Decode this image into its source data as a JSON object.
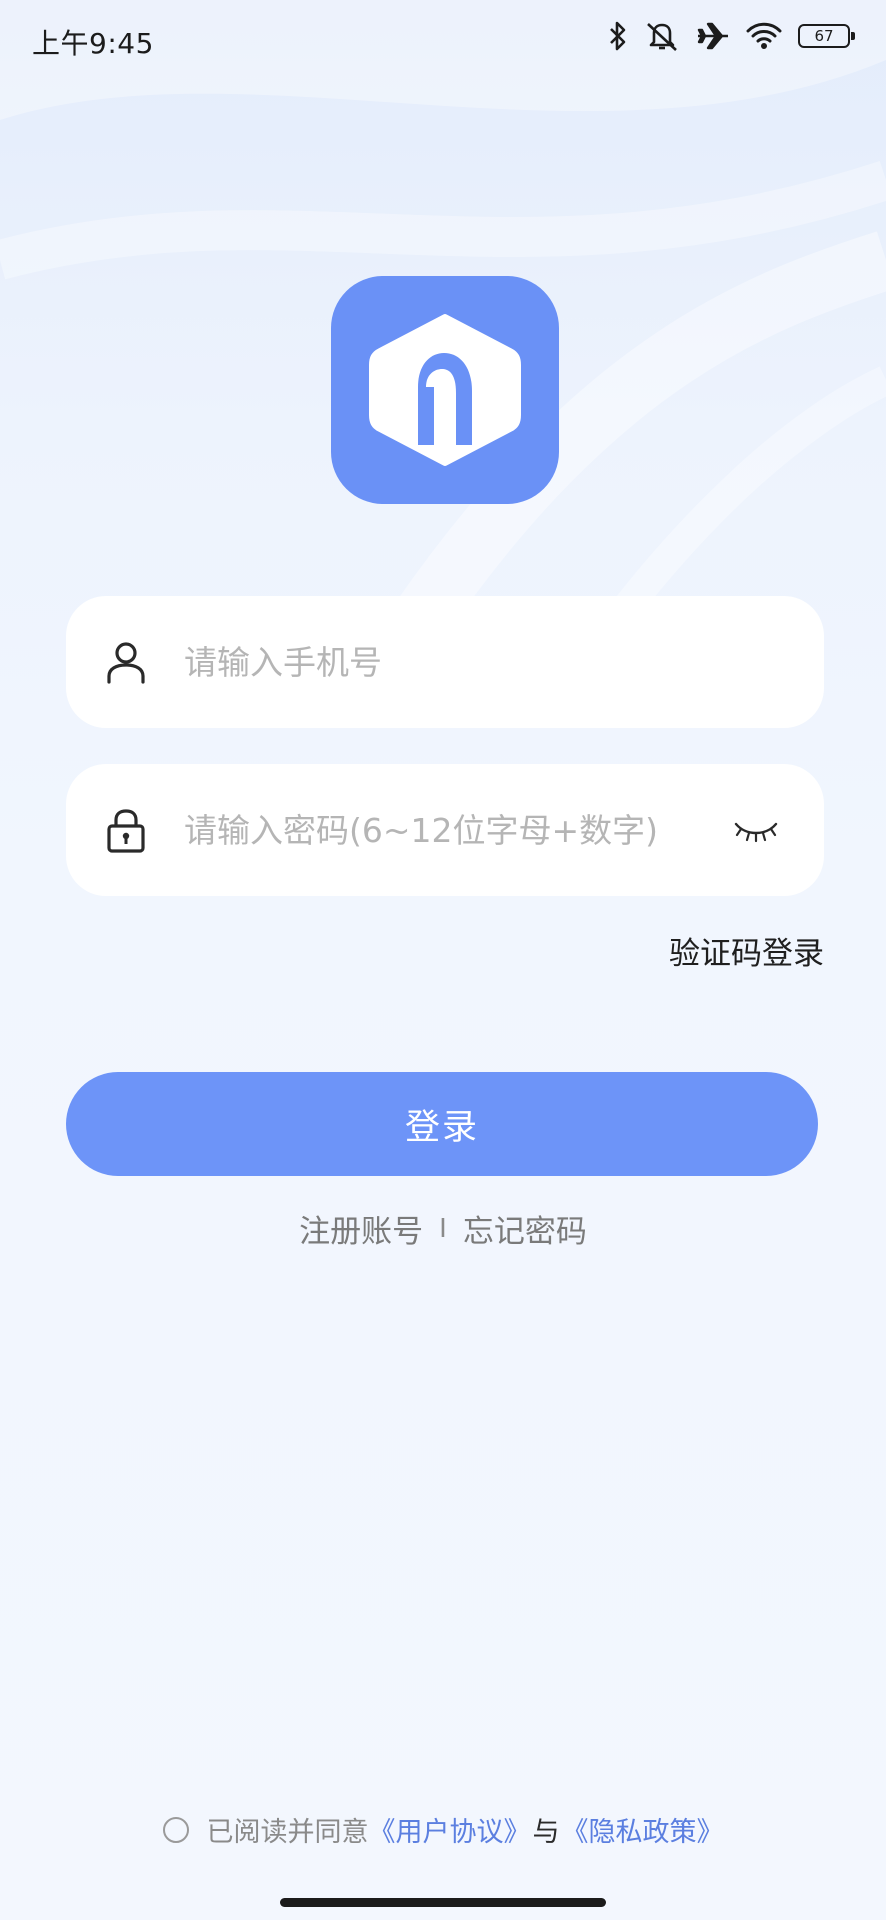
{
  "status_bar": {
    "time": "上午9:45",
    "battery_level": "67",
    "icons": [
      "bluetooth-icon",
      "mute-icon",
      "airplane-icon",
      "wifi-icon",
      "battery-icon"
    ]
  },
  "logo": {
    "icon": "app-logo-icon",
    "color": "#6a91f6"
  },
  "phone_field": {
    "icon": "user-icon",
    "placeholder": "请输入手机号",
    "value": ""
  },
  "password_field": {
    "icon": "lock-icon",
    "placeholder": "请输入密码(6~12位字母+数字)",
    "value": "",
    "toggle_icon": "eye-closed-icon"
  },
  "sms_login_label": "验证码登录",
  "login_button_label": "登录",
  "links": {
    "register": "注册账号",
    "divider": "I",
    "forgot_password": "忘记密码"
  },
  "agreement": {
    "prefix": "已阅读并同意",
    "user_agreement": "《用户协议》",
    "conjunction": "与",
    "privacy_policy": "《隐私政策》",
    "checked": false
  },
  "colors": {
    "accent": "#6d94f8",
    "link": "#5b7fe0"
  }
}
